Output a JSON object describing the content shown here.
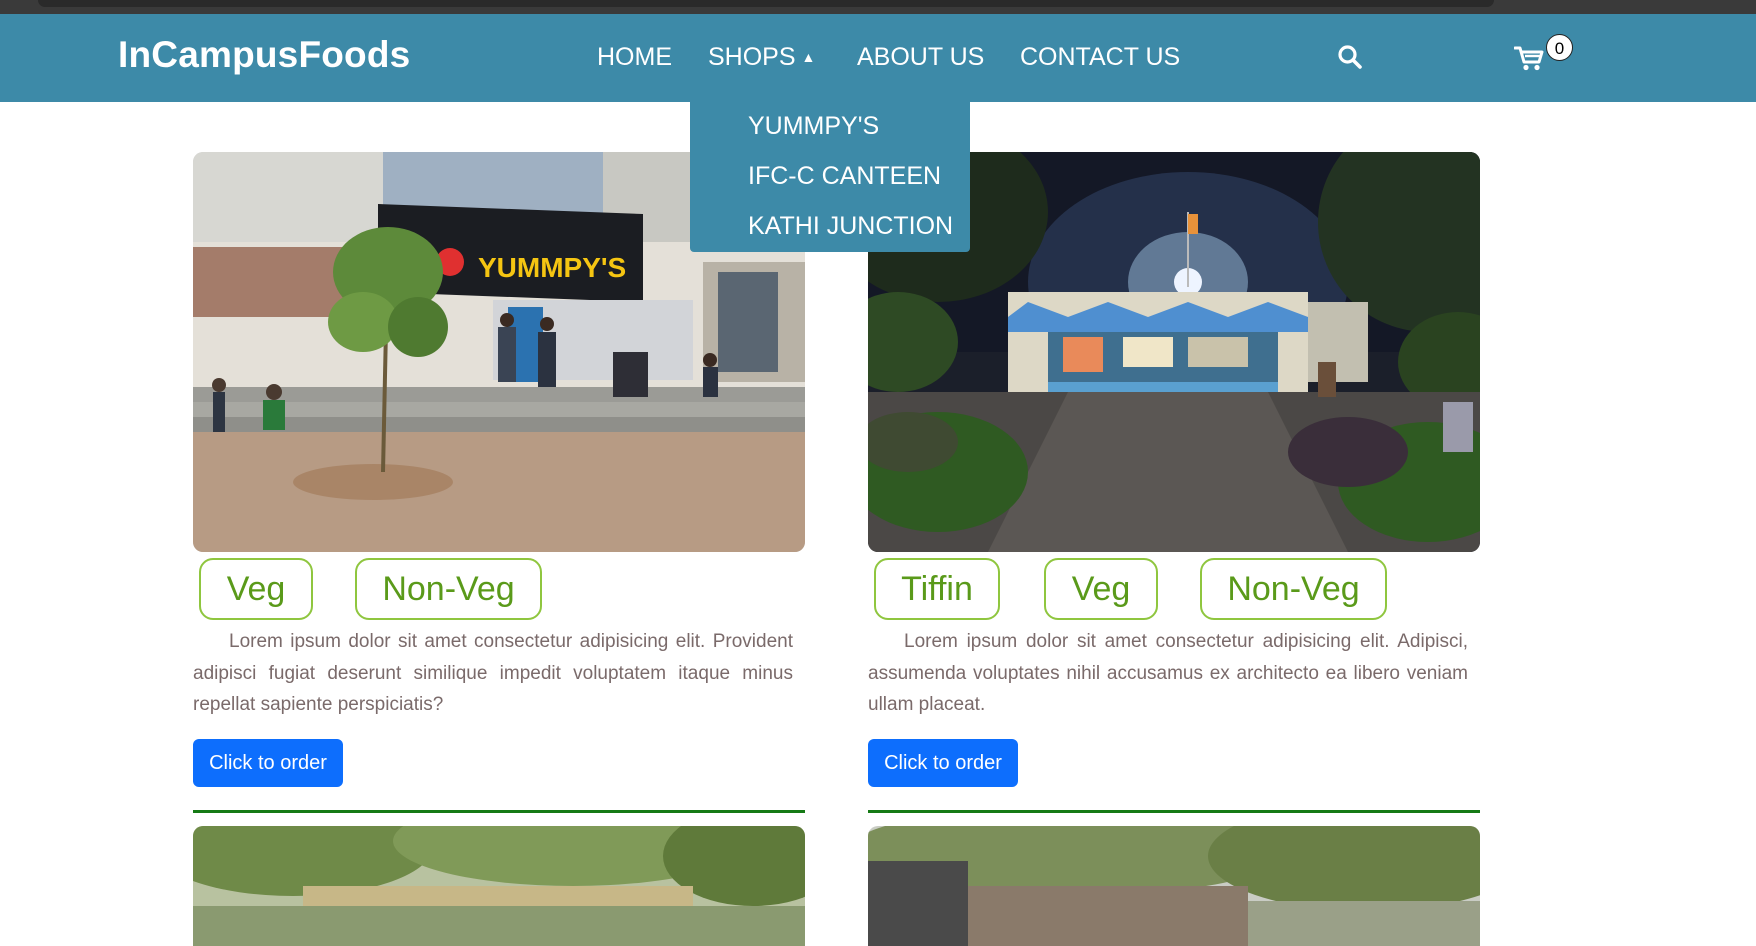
{
  "navbar": {
    "brand": "InCampusFoods",
    "links": [
      {
        "label": "HOME"
      },
      {
        "label": "SHOPS"
      },
      {
        "label": "ABOUT US"
      },
      {
        "label": "CONTACT US"
      }
    ],
    "search_icon": "search-icon",
    "cart_icon": "cart-icon",
    "cart_count": "0",
    "background_color": "#3d8aa8"
  },
  "shops_dropdown": {
    "items": [
      {
        "label": "YUMMPY'S"
      },
      {
        "label": "IFC-C CANTEEN"
      },
      {
        "label": "KATHI JUNCTION"
      }
    ]
  },
  "cards": [
    {
      "sign_text": "YUMMPY'S",
      "tags": [
        "Veg",
        "Non-Veg"
      ],
      "description": "Lorem ipsum dolor sit amet consectetur adipisicing elit. Provident adipisci fugiat deserunt similique impedit voluptatem itaque minus repellat sapiente perspiciatis?",
      "button_label": "Click to order"
    },
    {
      "tags": [
        "Tiffin",
        "Veg",
        "Non-Veg"
      ],
      "description": "Lorem ipsum dolor sit amet consectetur adipisicing elit. Adipisci, assumenda voluptates nihil accusamus ex architecto ea libero veniam ullam placeat.",
      "button_label": "Click to order"
    }
  ],
  "colors": {
    "tag_border": "#8fc63f",
    "tag_text": "#5a9a1a",
    "button": "#0d6efd",
    "divider": "#157a15"
  }
}
